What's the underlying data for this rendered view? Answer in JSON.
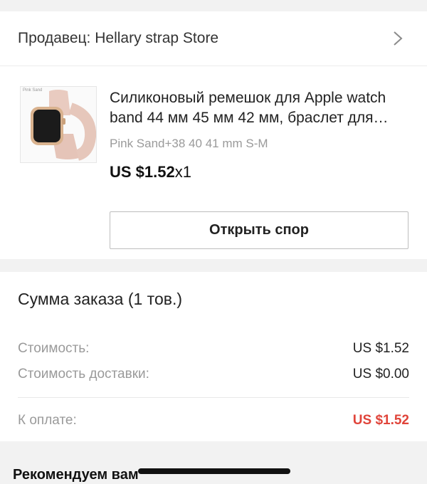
{
  "seller": {
    "label": "Продавец: Hellary strap Store"
  },
  "product": {
    "image_tag": "Pink Sand",
    "title": "Силиконовый ремешок для Apple watch band 44 мм 45 мм 42 мм, браслет для умных часов",
    "variant": "Pink Sand+38 40 41 mm S-M",
    "price": "US $1.52",
    "quantity": "x1",
    "dispute_button": "Открыть спор"
  },
  "summary": {
    "title": "Сумма заказа (1 тов.)",
    "cost_label": "Стоимость:",
    "cost_value": "US $1.52",
    "shipping_label": "Стоимость доставки:",
    "shipping_value": "US $0.00",
    "total_label": "К оплате:",
    "total_value": "US $1.52",
    "total_color": "#e0443a"
  },
  "recommend": {
    "title": "Рекомендуем вам"
  }
}
